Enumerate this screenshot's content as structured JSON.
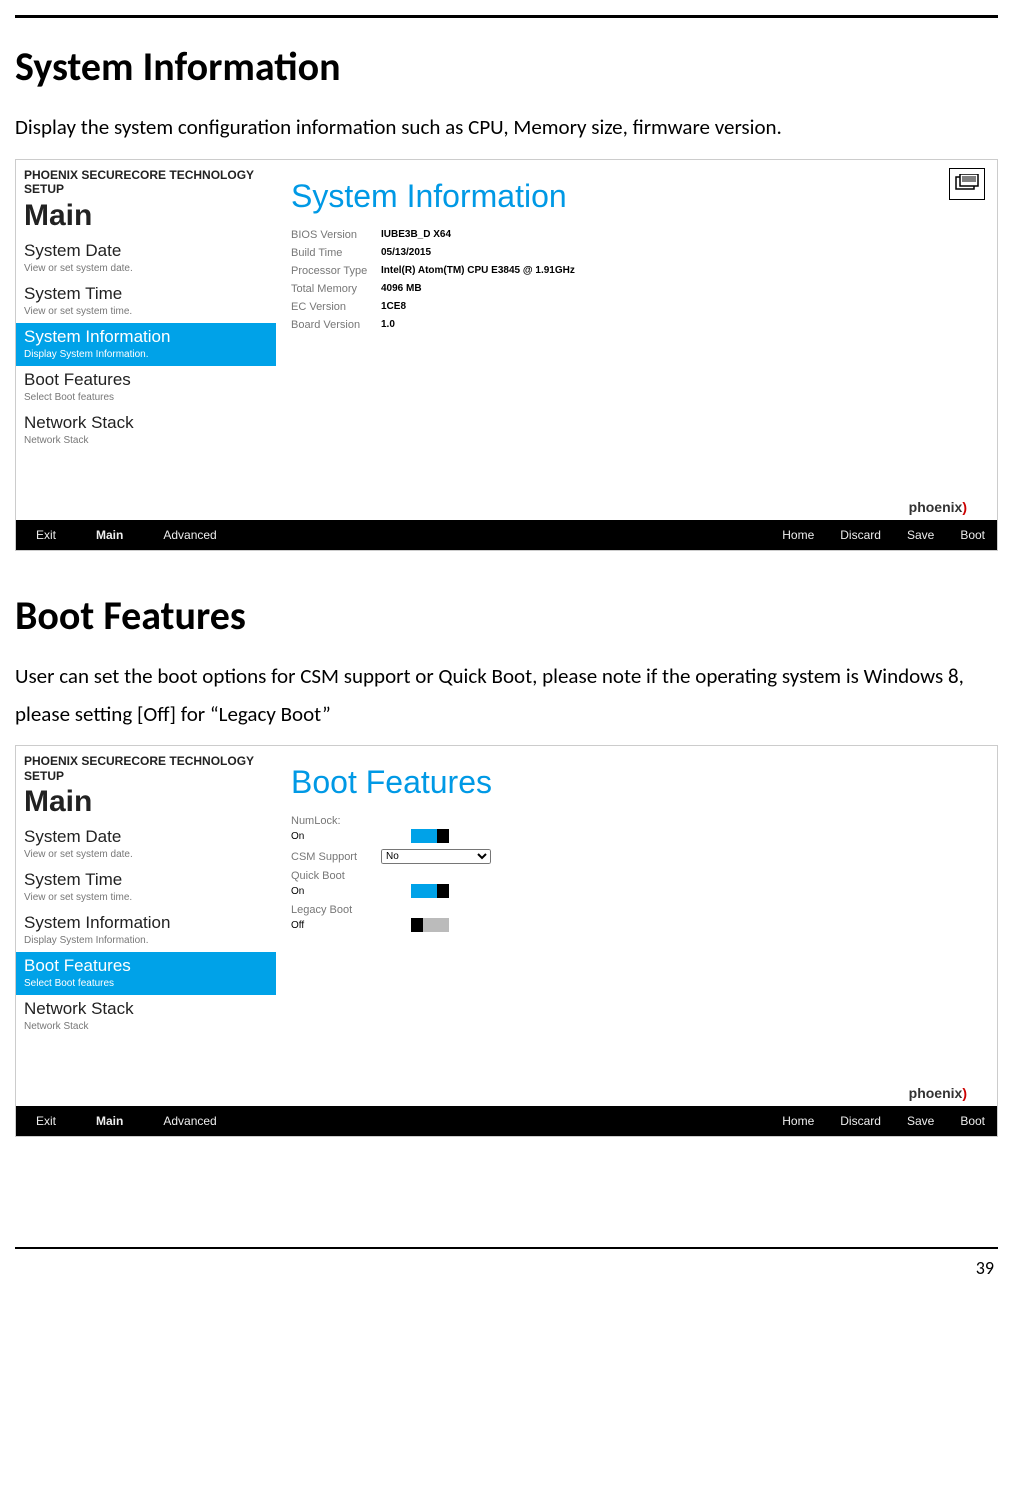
{
  "page_number": "39",
  "sections": {
    "sysinfo": {
      "heading": "System Information",
      "text": "Display the system configuration information such as CPU, Memory size, firmware version."
    },
    "boot": {
      "heading": "Boot Features",
      "text": "User can set the boot options for CSM support or Quick Boot, please note if the operating system is Windows 8, please setting [Off] for “Legacy Boot”"
    }
  },
  "shot": {
    "brand": "PHOENIX SECURECORE TECHNOLOGY SETUP",
    "sidebar_head": "Main",
    "items": [
      {
        "t": "System Date",
        "d": "View or set system date."
      },
      {
        "t": "System Time",
        "d": "View or set system time."
      },
      {
        "t": "System Information",
        "d": "Display System Information."
      },
      {
        "t": "Boot Features",
        "d": "Select Boot features"
      },
      {
        "t": "Network Stack",
        "d": "Network Stack"
      }
    ],
    "logo": "phoenix",
    "bottom": {
      "left": [
        "Exit",
        "Main",
        "Advanced"
      ],
      "right": [
        "Home",
        "Discard",
        "Save",
        "Boot"
      ]
    }
  },
  "sysinfo_panel": {
    "title": "System Information",
    "rows": [
      {
        "lab": "BIOS Version",
        "val": "IUBE3B_D X64"
      },
      {
        "lab": "Build Time",
        "val": "05/13/2015"
      },
      {
        "lab": "Processor Type",
        "val": "Intel(R) Atom(TM) CPU E3845 @ 1.91GHz"
      },
      {
        "lab": "Total Memory",
        "val": "4096 MB"
      },
      {
        "lab": "EC Version",
        "val": "1CE8"
      },
      {
        "lab": "Board Version",
        "val": "1.0"
      }
    ]
  },
  "boot_panel": {
    "title": "Boot Features",
    "numlock_lab": "NumLock:",
    "numlock_val": "On",
    "csm_lab": "CSM Support",
    "csm_val": "No",
    "quick_lab": "Quick Boot",
    "quick_val": "On",
    "legacy_lab": "Legacy Boot",
    "legacy_val": "Off"
  }
}
